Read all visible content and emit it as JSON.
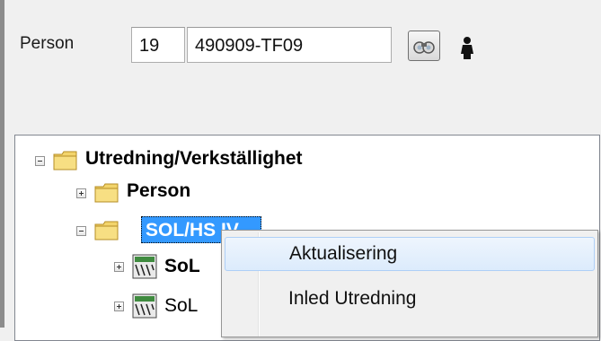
{
  "person_panel": {
    "label": "Person",
    "number_value": "19",
    "id_value": "490909-TF09",
    "search_button_icon": "binoculars-icon",
    "person_icon": "person-icon"
  },
  "tree": {
    "root": {
      "label": "Utredning/Verkställighet",
      "expanded": true,
      "icon": "folder-icon"
    },
    "children": [
      {
        "label": "Person",
        "expanded": false,
        "icon": "folder-icon"
      },
      {
        "label": "SOL/HS IV",
        "expanded": true,
        "selected": true,
        "icon": "folder-icon"
      }
    ],
    "grandchildren": [
      {
        "label": "SoL",
        "bold": true,
        "icon": "document-icon"
      },
      {
        "label": "SoL",
        "bold": false,
        "icon": "document-icon"
      }
    ]
  },
  "context_menu": {
    "items": [
      {
        "label": "Aktualisering",
        "highlighted": true
      },
      {
        "label": "Inled Utredning",
        "highlighted": false
      }
    ]
  },
  "colors": {
    "selection": "#3399ff",
    "folder": "#f2d46b",
    "menu_highlight": "#dcebfc"
  }
}
